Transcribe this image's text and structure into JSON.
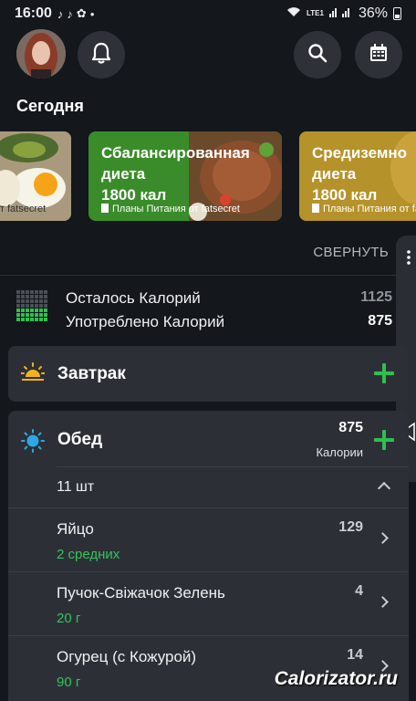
{
  "status_bar": {
    "time": "16:00",
    "network": "LTE1",
    "battery": "36%"
  },
  "header": {
    "title": "Сегодня"
  },
  "meal_plans": [
    {
      "title_line1": "",
      "title_line2": "",
      "calories": "",
      "source": "от fatsecret"
    },
    {
      "title_line1": "Сбалансированная",
      "title_line2": "диета",
      "calories": "1800 кал",
      "source": "Планы Питания от fatsecret"
    },
    {
      "title_line1": "Средиземно",
      "title_line2": "диета",
      "calories": "1800 кал",
      "source": "Планы Питания от fatsecret"
    }
  ],
  "collapse_label": "СВЕРНУТЬ",
  "summary": {
    "remaining_label": "Осталось Калорий",
    "remaining_value": "1125",
    "consumed_label": "Употреблено Калорий",
    "consumed_value": "875"
  },
  "meals": {
    "breakfast": {
      "title": "Завтрак"
    },
    "lunch": {
      "title": "Обед",
      "calories": "875",
      "calories_label": "Калории",
      "items_count": "11 шт",
      "items": [
        {
          "name": "Яйцо",
          "qty": "2 средних",
          "kcal": "129"
        },
        {
          "name": "Пучок-Свіжачок Зелень",
          "qty": "20 г",
          "kcal": "4"
        },
        {
          "name": "Огурец (с Кожурой)",
          "qty": "90 г",
          "kcal": "14"
        }
      ]
    }
  },
  "watermark": "Calorizator.ru",
  "colors": {
    "accent_green": "#2fbf4f",
    "background": "#14171c",
    "card": "#2c3036"
  }
}
